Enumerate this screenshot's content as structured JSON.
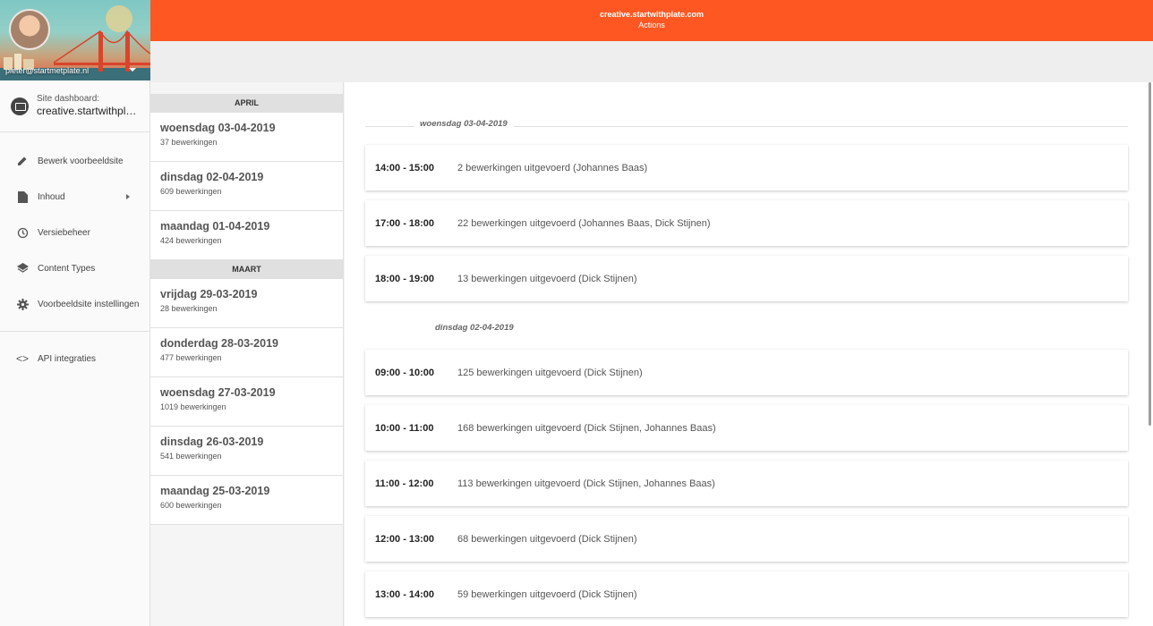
{
  "topbar": {
    "site": "creative.startwithplate.com",
    "subtitle": "Actions"
  },
  "sidebar": {
    "profile_email": "pieter@startmetplate.nl",
    "dashboard_label": "Site dashboard:",
    "dashboard_site": "creative.startwithplate.com",
    "items": [
      {
        "label": "Bewerk voorbeeldsite",
        "icon": "pencil-icon"
      },
      {
        "label": "Inhoud",
        "icon": "document-icon"
      },
      {
        "label": "Versiebeheer",
        "icon": "history-icon"
      },
      {
        "label": "Content Types",
        "icon": "layers-icon"
      },
      {
        "label": "Voorbeeldsite instellingen",
        "icon": "gear-icon"
      }
    ],
    "extra_items": [
      {
        "label": "API integraties",
        "icon": "code-icon"
      }
    ]
  },
  "datelist": {
    "months": [
      "APRIL",
      "MAART"
    ],
    "days": [
      {
        "date": "woensdag 03-04-2019",
        "count": "37 bewerkingen"
      },
      {
        "date": "dinsdag 02-04-2019",
        "count": "609 bewerkingen"
      },
      {
        "date": "maandag 01-04-2019",
        "count": "424 bewerkingen"
      },
      {
        "date": "vrijdag 29-03-2019",
        "count": "28 bewerkingen"
      },
      {
        "date": "donderdag 28-03-2019",
        "count": "477 bewerkingen"
      },
      {
        "date": "woensdag 27-03-2019",
        "count": "1019 bewerkingen"
      },
      {
        "date": "dinsdag 26-03-2019",
        "count": "541 bewerkingen"
      },
      {
        "date": "maandag 25-03-2019",
        "count": "600 bewerkingen"
      }
    ]
  },
  "main": {
    "groups": [
      {
        "label": "woensdag 03-04-2019",
        "entries": [
          {
            "time": "14:00 - 15:00",
            "summary": "2 bewerkingen uitgevoerd (Johannes Baas)"
          },
          {
            "time": "17:00 - 18:00",
            "summary": "22 bewerkingen uitgevoerd (Johannes Baas, Dick Stijnen)"
          },
          {
            "time": "18:00 - 19:00",
            "summary": "13 bewerkingen uitgevoerd (Dick Stijnen)"
          }
        ]
      },
      {
        "label": "dinsdag 02-04-2019",
        "entries": [
          {
            "time": "09:00 - 10:00",
            "summary": "125 bewerkingen uitgevoerd (Dick Stijnen)"
          },
          {
            "time": "10:00 - 11:00",
            "summary": "168 bewerkingen uitgevoerd (Dick Stijnen, Johannes Baas)"
          },
          {
            "time": "11:00 - 12:00",
            "summary": "113 bewerkingen uitgevoerd (Dick Stijnen, Johannes Baas)"
          },
          {
            "time": "12:00 - 13:00",
            "summary": "68 bewerkingen uitgevoerd (Dick Stijnen)"
          },
          {
            "time": "13:00 - 14:00",
            "summary": "59 bewerkingen uitgevoerd (Dick Stijnen)"
          }
        ]
      }
    ]
  },
  "colors": {
    "accent": "#ff5722",
    "subbar": "#eeeeee"
  }
}
